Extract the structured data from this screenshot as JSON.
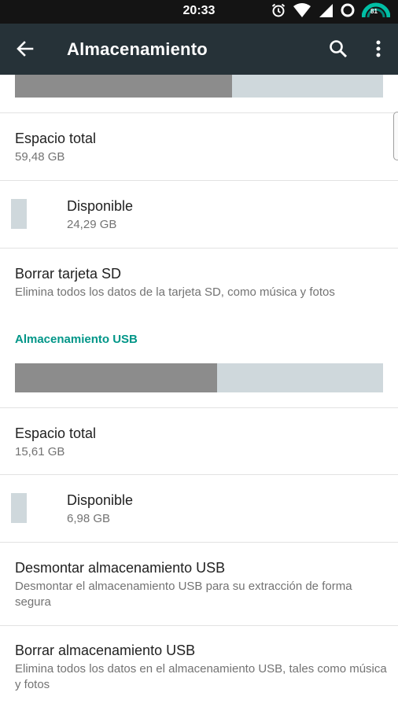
{
  "status_bar": {
    "time": "20:33",
    "battery_level": "81",
    "icons": [
      "alarm-icon",
      "wifi-icon",
      "signal-icon",
      "sync-icon",
      "battery-icon"
    ]
  },
  "app_bar": {
    "title": "Almacenamiento",
    "background": "#263238",
    "actions": [
      "back-arrow-icon",
      "search-icon",
      "more-vert-icon"
    ]
  },
  "sd_card": {
    "usage_bar": {
      "used_fraction": 0.59
    },
    "total_space": {
      "title": "Espacio total",
      "value": "59,48 GB"
    },
    "available": {
      "title": "Disponible",
      "value": "24,29 GB"
    },
    "erase": {
      "title": "Borrar tarjeta SD",
      "description": "Elimina todos los datos de la tarjeta SD, como música y fotos"
    }
  },
  "usb_storage": {
    "header": "Almacenamiento USB",
    "header_color": "#009688",
    "usage_bar": {
      "used_fraction": 0.55
    },
    "total_space": {
      "title": "Espacio total",
      "value": "15,61 GB"
    },
    "available": {
      "title": "Disponible",
      "value": "6,98 GB"
    },
    "unmount": {
      "title": "Desmontar almacenamiento USB",
      "description": "Desmontar el almacenamiento USB para su extracción de forma segura"
    },
    "erase": {
      "title": "Borrar almacenamiento USB",
      "description": "Elimina todos los datos en el almacenamiento USB, tales como música y fotos"
    }
  }
}
